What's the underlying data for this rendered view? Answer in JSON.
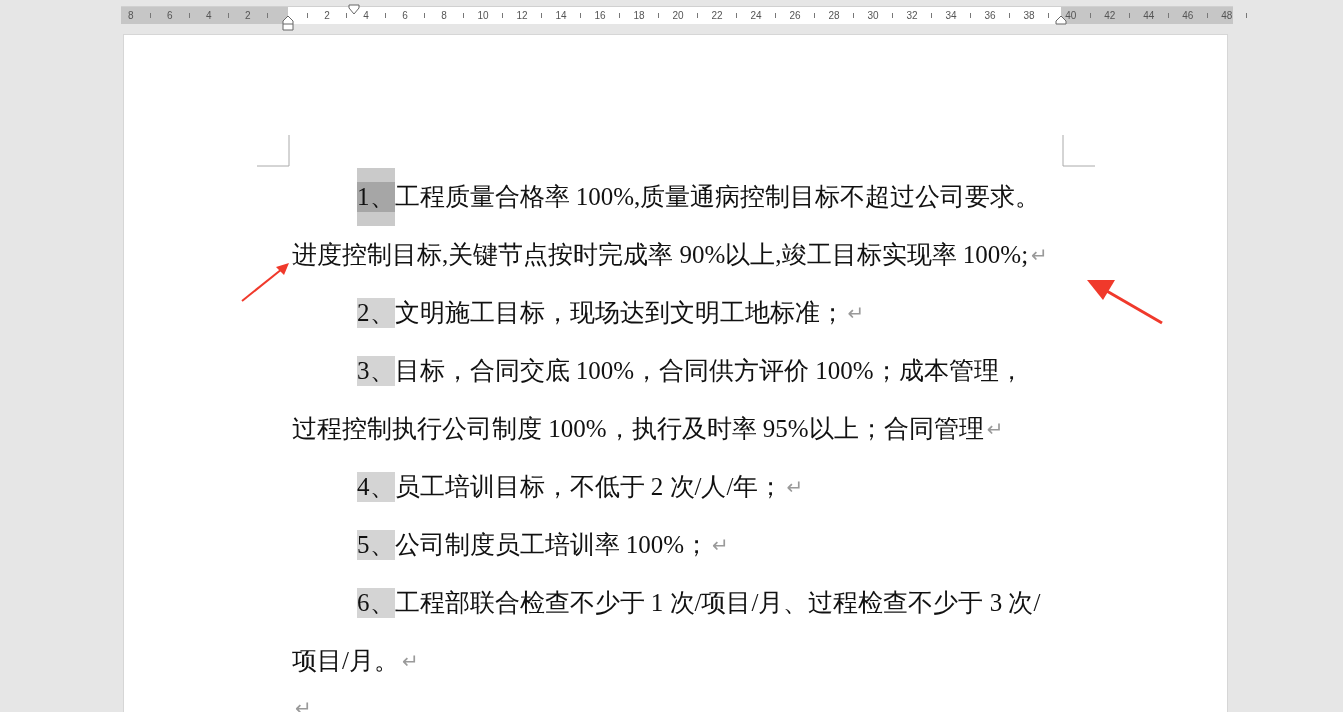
{
  "ruler": {
    "left_numbers": [
      "8",
      "6",
      "4",
      "2"
    ],
    "numbers": [
      "2",
      "4",
      "6",
      "8",
      "10",
      "12",
      "14",
      "16",
      "18",
      "20",
      "22",
      "24",
      "26",
      "28",
      "30",
      "32",
      "34",
      "36",
      "38"
    ],
    "right_numbers": [
      "40",
      "42",
      "44",
      "46",
      "48"
    ]
  },
  "paragraphs": [
    {
      "number": "1、",
      "selected": true,
      "lines": [
        "工程质量合格率 100%,质量通病控制目标不超过公司要求。",
        "进度控制目标,关键节点按时完成率 90%以上,竣工目标实现率 100%;"
      ],
      "end_mark": "↵"
    },
    {
      "number": "2、",
      "selected": false,
      "lines": [
        "文明施工目标，现场达到文明工地标准；"
      ],
      "end_mark": "↵"
    },
    {
      "number": "3、",
      "selected": false,
      "lines": [
        "目标，合同交底 100%，合同供方评价 100%；成本管理，",
        "过程控制执行公司制度 100%，执行及时率 95%以上；合同管理"
      ],
      "end_mark": "↵"
    },
    {
      "number": "4、",
      "selected": false,
      "lines": [
        "员工培训目标，不低于 2 次/人/年；"
      ],
      "end_mark": "↵"
    },
    {
      "number": "5、",
      "selected": false,
      "lines": [
        "公司制度员工培训率 100%；"
      ],
      "end_mark": "↵"
    },
    {
      "number": "6、",
      "selected": false,
      "lines": [
        "工程部联合检查不少于 1 次/项目/月、过程检查不少于 3 次/",
        "项目/月。"
      ],
      "end_mark": "↵"
    },
    {
      "end_mark": "↵"
    }
  ]
}
